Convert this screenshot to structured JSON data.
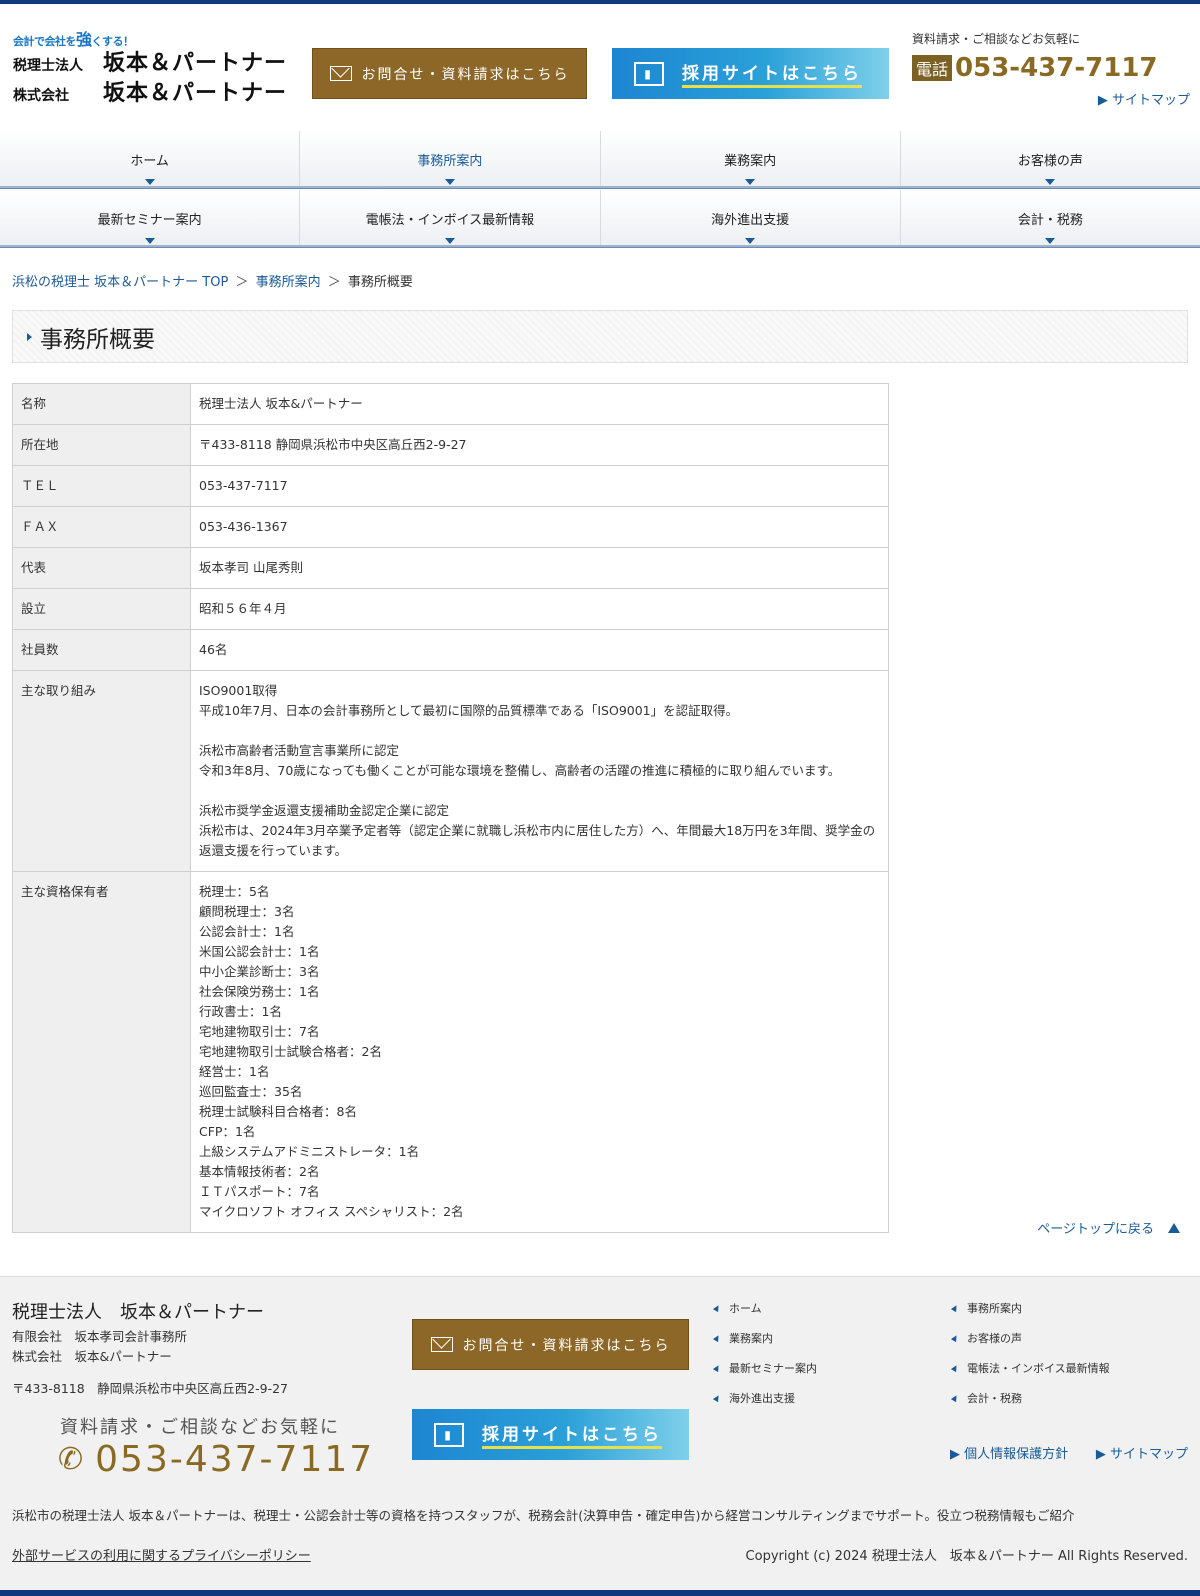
{
  "header": {
    "logo_tagline_1": "会計で会社を",
    "logo_tagline_big": "強",
    "logo_tagline_2": "くする！",
    "logo_type_1": "税理士法人",
    "logo_name_1": "坂本＆パートナー",
    "logo_type_2": "株式会社",
    "logo_name_2": "坂本＆パートナー",
    "contact_button": "お問合せ・資料請求はこちら",
    "recruit_button": "採用サイトはこちら",
    "contact_hint": "資料請求・ご相談などお気軽に",
    "tel_label": "電話",
    "tel_number": "053-437-7117",
    "sitemap_link": "▶ サイトマップ"
  },
  "nav_row1": [
    "ホーム",
    "事務所案内",
    "業務案内",
    "お客様の声"
  ],
  "nav_row2": [
    "最新セミナー案内",
    "電帳法・インボイス最新情報",
    "海外進出支援",
    "会計・税務"
  ],
  "breadcrumb": {
    "home": "浜松の税理士 坂本＆パートナー TOP",
    "sep": "＞",
    "parent": "事務所案内",
    "current": "事務所概要"
  },
  "page_title": "事務所概要",
  "table": [
    {
      "label": "名称",
      "value": "税理士法人 坂本&パートナー"
    },
    {
      "label": "所在地",
      "value": "〒433-8118 静岡県浜松市中央区高丘西2-9-27"
    },
    {
      "label": "ＴＥＬ",
      "value": "053-437-7117"
    },
    {
      "label": "ＦＡＸ",
      "value": "053-436-1367"
    },
    {
      "label": "代表",
      "value": "坂本孝司  山尾秀則"
    },
    {
      "label": "設立",
      "value": "昭和５６年４月"
    },
    {
      "label": "社員数",
      "value": "46名"
    }
  ],
  "initiatives": {
    "label": "主な取り組み",
    "items": [
      {
        "title": "ISO9001取得",
        "text": "平成10年7月、日本の会計事務所として最初に国際的品質標準である「ISO9001」を認証取得。"
      },
      {
        "title": "浜松市高齢者活動宣言事業所に認定",
        "text": "令和3年8月、70歳になっても働くことが可能な環境を整備し、高齢者の活躍の推進に積極的に取り組んでいます。"
      },
      {
        "title": "浜松市奨学金返還支援補助金認定企業に認定",
        "text": "浜松市は、2024年3月卒業予定者等（認定企業に就職し浜松市内に居住した方）へ、年間最大18万円を3年間、奨学金の返還支援を行っています。"
      }
    ]
  },
  "qualifications": {
    "label": "主な資格保有者",
    "items": [
      "税理士：5名",
      "顧問税理士：3名",
      "公認会計士：1名",
      "米国公認会計士：1名",
      "中小企業診断士：3名",
      "社会保険労務士：1名",
      "行政書士：1名",
      "宅地建物取引士：7名",
      "宅地建物取引士試験合格者：2名",
      "経営士：1名",
      "巡回監査士：35名",
      "税理士試験科目合格者：8名",
      "CFP：1名",
      "上級システムアドミニストレータ：1名",
      "基本情報技術者：2名",
      "ＩＴパスポート：7名",
      "マイクロソフト オフィス スペシャリスト：2名"
    ]
  },
  "page_top": "ページトップに戻る",
  "footer": {
    "name": "税理士法人　坂本＆パートナー",
    "sub1": "有限会社　坂本孝司会計事務所",
    "sub2": "株式会社　坂本&パートナー",
    "address": "〒433-8118　静岡県浜松市中央区高丘西2-9-27",
    "hint": "資料請求・ご相談などお気軽に",
    "tel": "053-437-7117",
    "contact_button": "お問合せ・資料請求はこちら",
    "recruit_button": "採用サイトはこちら",
    "links": [
      "ホーム",
      "事務所案内",
      "業務案内",
      "お客様の声",
      "最新セミナー案内",
      "電帳法・インボイス最新情報",
      "海外進出支援",
      "会計・税務"
    ],
    "policy_link": "▶ 個人情報保護方針",
    "sitemap_link": "▶ サイトマップ",
    "description": "浜松市の税理士法人 坂本＆パートナーは、税理士・公認会計士等の資格を持つスタッフが、税務会計(決算申告・確定申告)から経営コンサルティングまでサポート。役立つ税務情報もご紹介",
    "privacy_link": "外部サービスの利用に関するプライバシーポリシー",
    "copyright": "Copyright (c) 2024 税理士法人　坂本＆パートナー All Rights Reserved."
  },
  "colors": {
    "brand_navy": "#0d3a7a",
    "link_blue": "#1a5a96",
    "gold": "#8d6727",
    "recruit_blue": "#1d86d2"
  }
}
